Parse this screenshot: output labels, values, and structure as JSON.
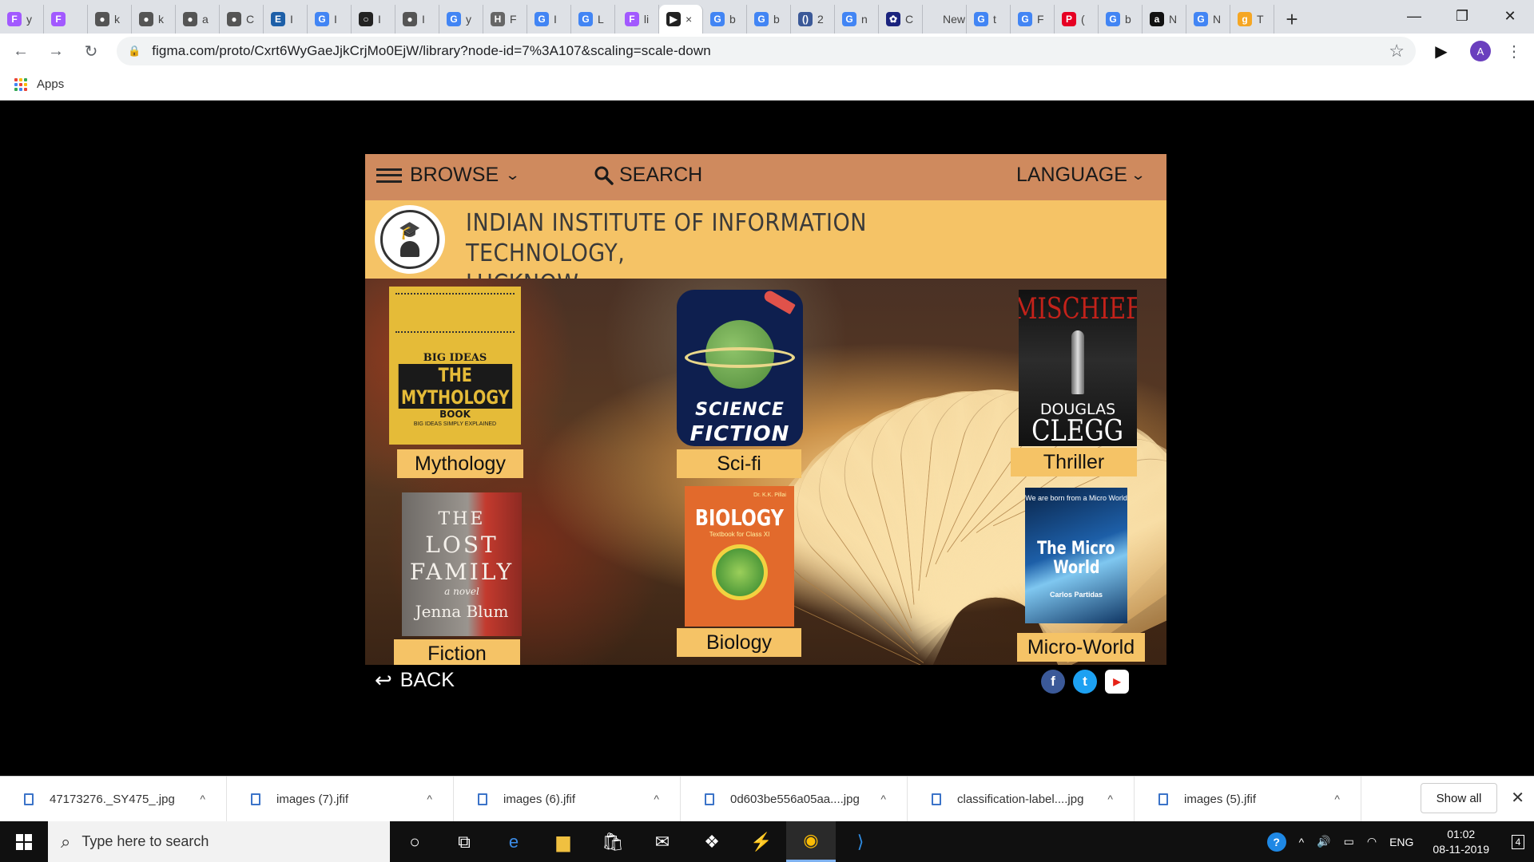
{
  "browser": {
    "tabs": [
      {
        "label": "y",
        "favicon": "F",
        "color": "#a259ff"
      },
      {
        "label": "",
        "favicon": "F",
        "color": "#a259ff"
      },
      {
        "label": "k",
        "favicon": "●",
        "color": "#555555"
      },
      {
        "label": "k",
        "favicon": "●",
        "color": "#555555"
      },
      {
        "label": "a",
        "favicon": "●",
        "color": "#555555"
      },
      {
        "label": "C",
        "favicon": "●",
        "color": "#555555"
      },
      {
        "label": "I",
        "favicon": "E",
        "color": "#1d5fa8"
      },
      {
        "label": "I",
        "favicon": "G",
        "color": "#4285f4"
      },
      {
        "label": "I",
        "favicon": "○",
        "color": "#222222"
      },
      {
        "label": "I",
        "favicon": "●",
        "color": "#555555"
      },
      {
        "label": "y",
        "favicon": "G",
        "color": "#4285f4"
      },
      {
        "label": "F",
        "favicon": "H",
        "color": "#666666"
      },
      {
        "label": "I",
        "favicon": "G",
        "color": "#4285f4"
      },
      {
        "label": "L",
        "favicon": "G",
        "color": "#4285f4"
      },
      {
        "label": "li",
        "favicon": "F",
        "color": "#a259ff"
      },
      {
        "label": "×",
        "favicon": "▶",
        "color": "#222222"
      },
      {
        "label": "b",
        "favicon": "G",
        "color": "#4285f4"
      },
      {
        "label": "b",
        "favicon": "G",
        "color": "#4285f4"
      },
      {
        "label": "2",
        "favicon": "()",
        "color": "#3b5998"
      },
      {
        "label": "n",
        "favicon": "G",
        "color": "#4285f4"
      },
      {
        "label": "C",
        "favicon": "✿",
        "color": "#1a237e"
      },
      {
        "label": "New",
        "favicon": "",
        "color": "#dee1e6"
      },
      {
        "label": "t",
        "favicon": "G",
        "color": "#4285f4"
      },
      {
        "label": "F",
        "favicon": "G",
        "color": "#4285f4"
      },
      {
        "label": "(",
        "favicon": "P",
        "color": "#e60023"
      },
      {
        "label": "b",
        "favicon": "G",
        "color": "#4285f4"
      },
      {
        "label": "N",
        "favicon": "a",
        "color": "#111111"
      },
      {
        "label": "N",
        "favicon": "G",
        "color": "#4285f4"
      },
      {
        "label": "T",
        "favicon": "g",
        "color": "#f5a623"
      }
    ],
    "active_tab_index": 15,
    "new_tab_symbol": "+",
    "window_controls": {
      "minimize": "—",
      "maximize": "❐",
      "close": "✕"
    },
    "nav": {
      "back": "←",
      "forward": "→",
      "reload": "↻"
    },
    "url": "figma.com/proto/Cxrt6WyGaeJjkCrjMo0EjW/library?node-id=7%3A107&scaling=scale-down",
    "lock_symbol": "🔒",
    "star_symbol": "☆",
    "extension_symbol": "▶",
    "avatar_letter": "A",
    "menu_symbol": "⋮",
    "bookmarks": {
      "apps_label": "Apps",
      "apps_colors": [
        "#ea4335",
        "#fbbc05",
        "#34a853",
        "#4285f4",
        "#ea4335",
        "#fbbc05",
        "#34a853",
        "#4285f4",
        "#ea4335"
      ]
    }
  },
  "app": {
    "nav": {
      "browse": "BROWSE",
      "search": "SEARCH",
      "language": "LANGUAGE",
      "chevron": "⌄",
      "search_icon": "search-icon"
    },
    "institute": {
      "line1": "INDIAN INSTITUTE OF INFORMATION TECHNOLOGY,",
      "line2": "LUCKNOW",
      "logo_icon": "graduate-logo"
    },
    "categories": [
      {
        "id": "myth",
        "label": "Mythology",
        "cover": {
          "top": "BIG IDEAS",
          "title": "THE MYTHOLOGY",
          "sub": "BOOK",
          "tag": "BIG IDEAS SIMPLY EXPLAINED"
        }
      },
      {
        "id": "scifi",
        "label": "Sci-fi",
        "cover": {
          "line1": "SCIENCE",
          "line2": "FICTION"
        }
      },
      {
        "id": "thriller",
        "label": "Thriller",
        "cover": {
          "title": "MISCHIEF",
          "author1": "DOUGLAS",
          "author2": "CLEGG"
        }
      },
      {
        "id": "fiction",
        "label": "Fiction",
        "cover": {
          "line1": "THE",
          "line2": "LOST",
          "line3": "FAMILY",
          "tag": "a novel",
          "author": "Jenna Blum"
        }
      },
      {
        "id": "biology",
        "label": "Biology",
        "cover": {
          "authors": "Dr. K.K. Pillai",
          "title": "BIOLOGY",
          "sub": "Textbook for Class XI"
        }
      },
      {
        "id": "micro",
        "label": "Micro-World",
        "cover": {
          "tag": "We are born from a Micro World",
          "title1": "The Micro",
          "title2": "World",
          "author": "Carlos Partidas"
        }
      }
    ],
    "back_label": "BACK",
    "back_arrow": "↩",
    "social": {
      "facebook": "f",
      "twitter": "t",
      "youtube": "▶"
    }
  },
  "downloads": {
    "items": [
      "47173276._SY475_.jpg",
      "images (7).jfif",
      "images (6).jfif",
      "0d603be556a05aa....jpg",
      "classification-label....jpg",
      "images (5).jfif"
    ],
    "caret": "^",
    "show_all": "Show all",
    "close": "✕"
  },
  "taskbar": {
    "search_placeholder": "Type here to search",
    "search_glyph": "⌕",
    "icons": [
      "○",
      "⧉",
      "e",
      "▆",
      "🛍",
      "✉",
      "❖",
      "⚡",
      "◉",
      "⟩"
    ],
    "active_index": 8,
    "tray": {
      "help": "?",
      "chevron": "^",
      "volume": "🔊",
      "battery": "▭",
      "wifi": "◠",
      "language": "ENG"
    },
    "time": "01:02",
    "date": "08-11-2019",
    "notifications": "4"
  }
}
